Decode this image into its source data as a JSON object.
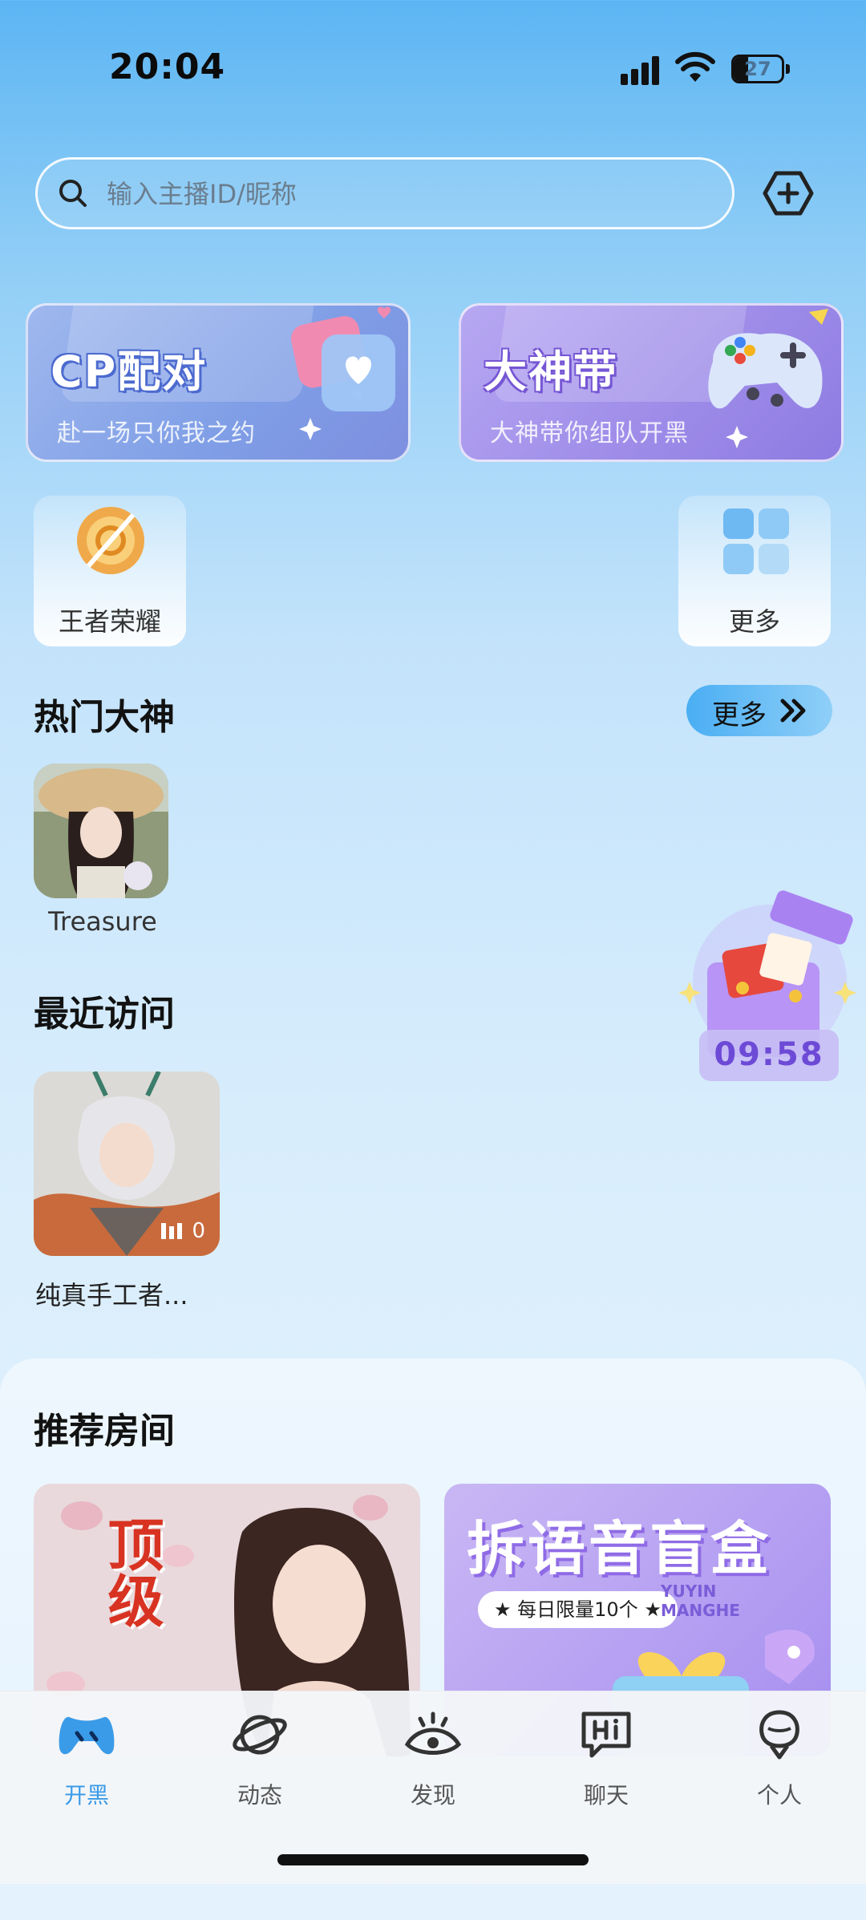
{
  "status_bar": {
    "time": "20:04",
    "battery": "27"
  },
  "search": {
    "placeholder": "输入主播ID/昵称"
  },
  "banners": [
    {
      "title": "CP配对",
      "subtitle": "赴一场只你我之约"
    },
    {
      "title": "大神带",
      "subtitle": "大神带你组队开黑"
    }
  ],
  "categories": [
    {
      "label": "王者荣耀",
      "icon": "game-badge-icon"
    },
    {
      "label": "更多",
      "icon": "grid-icon"
    }
  ],
  "hot_gods": {
    "title": "热门大神",
    "more_label": "更多",
    "items": [
      {
        "name": "Treasure"
      }
    ]
  },
  "recent": {
    "title": "最近访问",
    "items": [
      {
        "name": "纯真手工者...",
        "hot": "0"
      }
    ]
  },
  "gift": {
    "timer": "09:58"
  },
  "recommended": {
    "title": "推荐房间",
    "rooms": [
      {
        "cover_text": "顶级"
      },
      {
        "cover_title": "拆语音盲盒",
        "cover_sub": "每日限量10个",
        "cover_tag": "YUYIN MANGHE"
      }
    ]
  },
  "tabbar": [
    {
      "label": "开黑",
      "active": true,
      "icon": "gamepad-icon"
    },
    {
      "label": "动态",
      "active": false,
      "icon": "planet-icon"
    },
    {
      "label": "发现",
      "active": false,
      "icon": "eye-icon"
    },
    {
      "label": "聊天",
      "active": false,
      "icon": "hi-chat-icon"
    },
    {
      "label": "个人",
      "active": false,
      "icon": "person-icon"
    }
  ],
  "colors": {
    "accent": "#3a9be8",
    "timer": "#6d4ad6"
  }
}
